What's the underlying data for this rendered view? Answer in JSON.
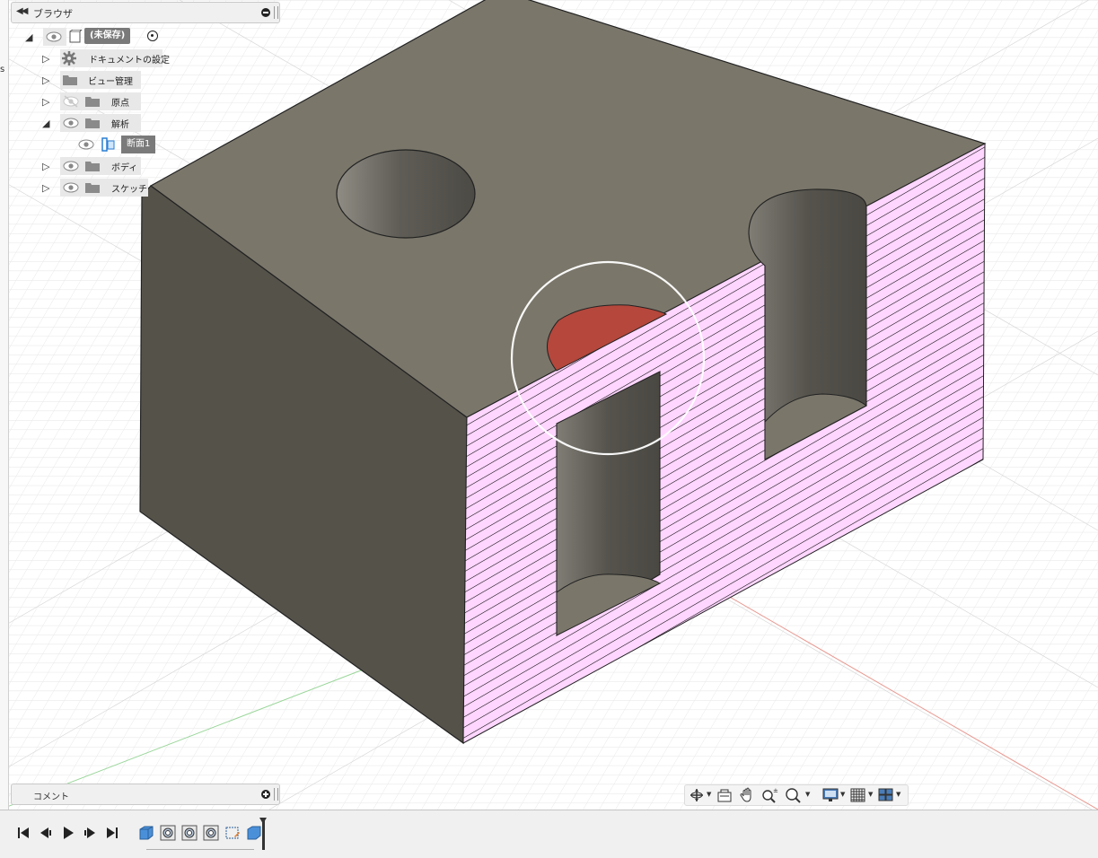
{
  "browser": {
    "title": "ブラウザ",
    "root_label": "(未保存)",
    "items": [
      {
        "label": "ドキュメントの設定",
        "icon": "gear-icon"
      },
      {
        "label": "ビュー管理",
        "icon": "folder-icon"
      },
      {
        "label": "原点",
        "icon": "folder-icon",
        "visibility": "hidden"
      },
      {
        "label": "解析",
        "icon": "folder-icon",
        "expanded": true
      },
      {
        "label": "断面1",
        "icon": "section-analysis-icon"
      },
      {
        "label": "ボディ",
        "icon": "folder-icon"
      },
      {
        "label": "スケッチ",
        "icon": "folder-icon"
      }
    ]
  },
  "comment": {
    "title": "コメント"
  },
  "left_edge_text": "s",
  "colors": {
    "top_face": "#7a766a",
    "left_face": "#55524a",
    "hatch_background": "#ffd6ff",
    "hatch_lines": "#000000",
    "hole_cut": "#b5473c",
    "grid": "#dcdcdc",
    "x_axis": "#e0453a",
    "y_axis": "#4ac54a"
  },
  "nav_toolbar": {
    "icons": [
      "orbit-icon",
      "look-at-icon",
      "pan-icon",
      "zoom-icon",
      "fit-icon",
      "display-settings-icon",
      "grid-settings-icon",
      "viewports-icon"
    ]
  },
  "timeline": {
    "controls": [
      "go-to-start-icon",
      "step-back-icon",
      "play-icon",
      "step-forward-icon",
      "go-to-end-icon"
    ],
    "features": [
      "extrude-feature-icon",
      "hole-feature-icon",
      "hole-feature-icon",
      "hole-feature-icon",
      "sketch-feature-icon",
      "section-feature-icon"
    ]
  }
}
